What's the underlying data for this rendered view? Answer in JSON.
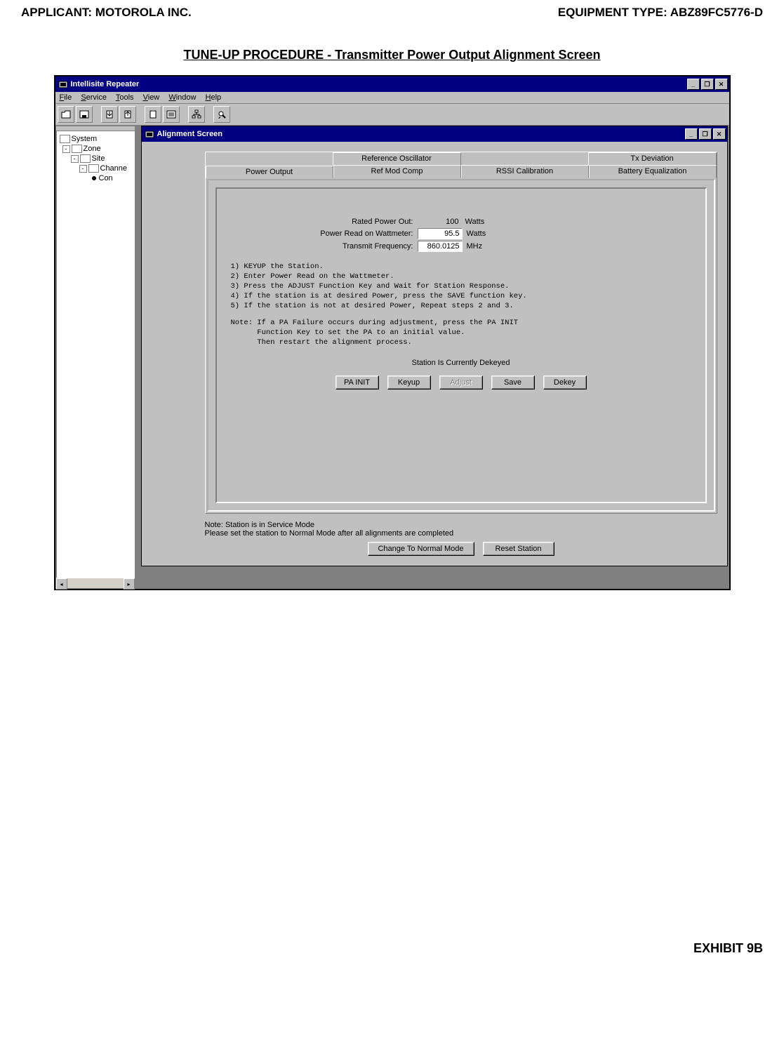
{
  "page": {
    "applicant_label": "APPLICANT:  MOTOROLA  INC.",
    "equipment_label": "EQUIPMENT TYPE:  ABZ89FC5776-D",
    "title": "TUNE-UP PROCEDURE - Transmitter Power Output Alignment Screen",
    "footer": "EXHIBIT 9B"
  },
  "app": {
    "title": "Intellisite Repeater",
    "menus": {
      "file": "File",
      "service": "Service",
      "tools": "Tools",
      "view": "View",
      "window": "Window",
      "help": "Help"
    },
    "toolbar_icons": {
      "open": "open-icon",
      "save": "save-icon",
      "read": "read-device-icon",
      "write": "write-device-icon",
      "clipboard": "clipboard-icon",
      "list": "list-icon",
      "tree": "tree-icon",
      "find": "find-icon"
    }
  },
  "tree": {
    "nodes": {
      "system": "System",
      "zone": "Zone",
      "site": "Site",
      "channel": "Channe",
      "con": "Con"
    }
  },
  "child": {
    "title": "Alignment Screen",
    "tabs_back": {
      "reference_oscillator": "Reference Oscillator",
      "tx_deviation": "Tx Deviation"
    },
    "tabs_front": {
      "power_output": "Power Output",
      "ref_mod_comp": "Ref Mod Comp",
      "rssi_calibration": "RSSI Calibration",
      "battery_equalization": "Battery Equalization"
    },
    "fields": {
      "rated_power_label": "Rated Power Out:",
      "rated_power_value": "100",
      "rated_power_unit": "Watts",
      "power_read_label": "Power Read on Wattmeter:",
      "power_read_value": "95.5",
      "power_read_unit": "Watts",
      "transmit_freq_label": "Transmit Frequency:",
      "transmit_freq_value": "860.0125",
      "transmit_freq_unit": "MHz"
    },
    "instructions": {
      "l1": "1) KEYUP the Station.",
      "l2": "2) Enter Power Read on the Wattmeter.",
      "l3": "3) Press the ADJUST Function Key and Wait for Station Response.",
      "l4": "4) If the station is at desired Power, press the SAVE function key.",
      "l5": "5) If the station is not at desired Power, Repeat steps 2 and 3.",
      "n1": "Note: If a PA Failure occurs during adjustment, press the PA INIT",
      "n2": "      Function Key to set the PA to an initial value.",
      "n3": "      Then restart the alignment process."
    },
    "status": "Station Is Currently Dekeyed",
    "buttons": {
      "pa_init": "PA INIT",
      "keyup": "Keyup",
      "adjust": "Adjust",
      "save": "Save",
      "dekey": "Dekey"
    },
    "footer_note1": "Note: Station is in Service Mode",
    "footer_note2": "Please set the station to Normal Mode after all alignments are completed",
    "footer_buttons": {
      "normal_mode": "Change To Normal Mode",
      "reset_station": "Reset Station"
    }
  }
}
